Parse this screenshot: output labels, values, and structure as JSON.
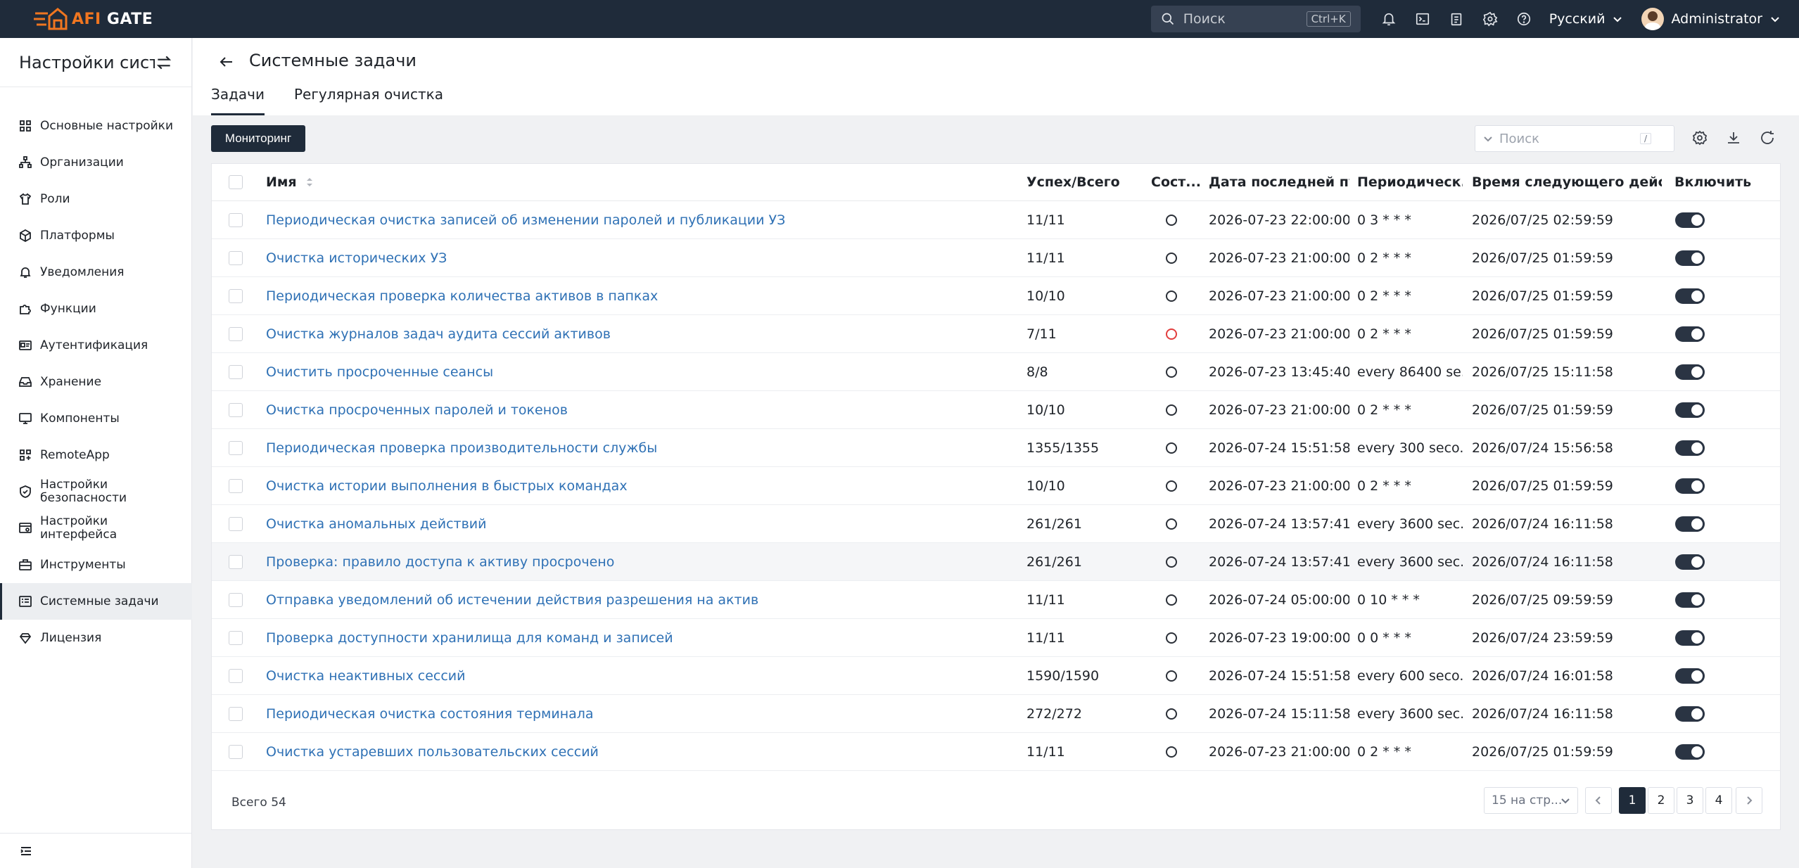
{
  "brand": {
    "name_part1": "AFI",
    "name_part2": " GATE"
  },
  "topbar": {
    "search_placeholder": "Поиск",
    "search_shortcut": "Ctrl+K",
    "language": "Русский",
    "user": "Administrator"
  },
  "sidebar": {
    "title": "Настройки сист...",
    "items": [
      {
        "label": "Основные настройки",
        "icon": "grid-icon"
      },
      {
        "label": "Организации",
        "icon": "org-icon"
      },
      {
        "label": "Роли",
        "icon": "shirt-icon"
      },
      {
        "label": "Платформы",
        "icon": "cube-icon"
      },
      {
        "label": "Уведомления",
        "icon": "bell-icon"
      },
      {
        "label": "Функции",
        "icon": "puzzle-icon"
      },
      {
        "label": "Аутентификация",
        "icon": "id-card-icon"
      },
      {
        "label": "Хранение",
        "icon": "inbox-icon"
      },
      {
        "label": "Компоненты",
        "icon": "monitor-icon"
      },
      {
        "label": "RemoteApp",
        "icon": "apps-icon"
      },
      {
        "label": "Настройки безопасности",
        "icon": "shield-icon"
      },
      {
        "label": "Настройки интерфейса",
        "icon": "ui-icon"
      },
      {
        "label": "Инструменты",
        "icon": "toolbox-icon"
      },
      {
        "label": "Системные задачи",
        "icon": "tasks-icon"
      },
      {
        "label": "Лицензия",
        "icon": "diamond-icon"
      }
    ]
  },
  "page": {
    "title": "Системные задачи",
    "tabs": [
      "Задачи",
      "Регулярная очистка"
    ],
    "monitor_button": "Мониторинг",
    "search_placeholder": "Поиск",
    "search_shortcut": "/"
  },
  "table": {
    "headers": {
      "name": "Имя",
      "success": "Успех/Всего",
      "state": "Сост...",
      "last_run": "Дата последней пу...",
      "period": "Периодическ...",
      "next_run": "Время следующего действия",
      "enabled": "Включить"
    },
    "rows": [
      {
        "name": "Периодическая очистка записей об изменении паролей и публикации УЗ",
        "success": "11/11",
        "status": "ok",
        "last_run": "2026-07-23 22:00:00",
        "period": "0 3 * * *",
        "next_run": "2026/07/25 02:59:59",
        "enabled": true
      },
      {
        "name": "Очистка исторических УЗ",
        "success": "11/11",
        "status": "ok",
        "last_run": "2026-07-23 21:00:00",
        "period": "0 2 * * *",
        "next_run": "2026/07/25 01:59:59",
        "enabled": true
      },
      {
        "name": "Периодическая проверка количества активов в папках",
        "success": "10/10",
        "status": "ok",
        "last_run": "2026-07-23 21:00:00",
        "period": "0 2 * * *",
        "next_run": "2026/07/25 01:59:59",
        "enabled": true
      },
      {
        "name": "Очистка журналов задач аудита сессий активов",
        "success": "7/11",
        "status": "error",
        "last_run": "2026-07-23 21:00:00",
        "period": "0 2 * * *",
        "next_run": "2026/07/25 01:59:59",
        "enabled": true
      },
      {
        "name": "Очистить просроченные сеансы",
        "success": "8/8",
        "status": "ok",
        "last_run": "2026-07-23 13:45:40",
        "period": "every 86400 se...",
        "next_run": "2026/07/25 15:11:58",
        "enabled": true
      },
      {
        "name": "Очистка просроченных паролей и токенов",
        "success": "10/10",
        "status": "ok",
        "last_run": "2026-07-23 21:00:00",
        "period": "0 2 * * *",
        "next_run": "2026/07/25 01:59:59",
        "enabled": true
      },
      {
        "name": "Периодическая проверка производительности службы",
        "success": "1355/1355",
        "status": "ok",
        "last_run": "2026-07-24 15:51:58",
        "period": "every 300 seco...",
        "next_run": "2026/07/24 15:56:58",
        "enabled": true
      },
      {
        "name": "Очистка истории выполнения в быстрых командах",
        "success": "10/10",
        "status": "ok",
        "last_run": "2026-07-23 21:00:00",
        "period": "0 2 * * *",
        "next_run": "2026/07/25 01:59:59",
        "enabled": true
      },
      {
        "name": "Очистка аномальных действий",
        "success": "261/261",
        "status": "ok",
        "last_run": "2026-07-24 13:57:41",
        "period": "every 3600 sec...",
        "next_run": "2026/07/24 16:11:58",
        "enabled": true
      },
      {
        "name": "Проверка: правило доступа к активу просрочено",
        "success": "261/261",
        "status": "ok",
        "last_run": "2026-07-24 13:57:41",
        "period": "every 3600 sec...",
        "next_run": "2026/07/24 16:11:58",
        "enabled": true
      },
      {
        "name": "Отправка уведомлений об истечении действия разрешения на актив",
        "success": "11/11",
        "status": "ok",
        "last_run": "2026-07-24 05:00:00",
        "period": "0 10 * * *",
        "next_run": "2026/07/25 09:59:59",
        "enabled": true
      },
      {
        "name": "Проверка доступности хранилища для команд и записей",
        "success": "11/11",
        "status": "ok",
        "last_run": "2026-07-23 19:00:00",
        "period": "0 0 * * *",
        "next_run": "2026/07/24 23:59:59",
        "enabled": true
      },
      {
        "name": "Очистка неактивных сессий",
        "success": "1590/1590",
        "status": "ok",
        "last_run": "2026-07-24 15:51:58",
        "period": "every 600 seco...",
        "next_run": "2026/07/24 16:01:58",
        "enabled": true
      },
      {
        "name": "Периодическая очистка состояния терминала",
        "success": "272/272",
        "status": "ok",
        "last_run": "2026-07-24 15:11:58",
        "period": "every 3600 sec...",
        "next_run": "2026/07/24 16:11:58",
        "enabled": true
      },
      {
        "name": "Очистка устаревших пользовательских сессий",
        "success": "11/11",
        "status": "ok",
        "last_run": "2026-07-23 21:00:00",
        "period": "0 2 * * *",
        "next_run": "2026/07/25 01:59:59",
        "enabled": true
      }
    ]
  },
  "pagination": {
    "total": "Всего 54",
    "page_size": "15 на стр...",
    "pages": [
      "1",
      "2",
      "3",
      "4"
    ],
    "current": "1"
  },
  "colors": {
    "topbar": "#1f2b3a",
    "accent": "#f07620",
    "link": "#2f71b5",
    "error": "#e23d3d"
  }
}
